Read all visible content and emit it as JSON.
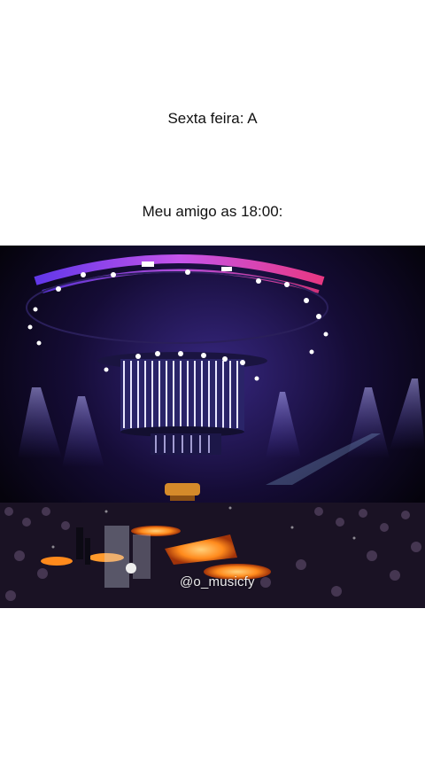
{
  "captions": {
    "line1": "Sexta feira: A",
    "line2": "Meu amigo as 18:00:"
  },
  "photo": {
    "subject": "concert-arena",
    "watermark": "@o_musicfy"
  },
  "colors": {
    "background": "#ffffff",
    "text": "#111111",
    "stage_purple": "#7a3cff",
    "stage_orange": "#ff8a1c"
  }
}
